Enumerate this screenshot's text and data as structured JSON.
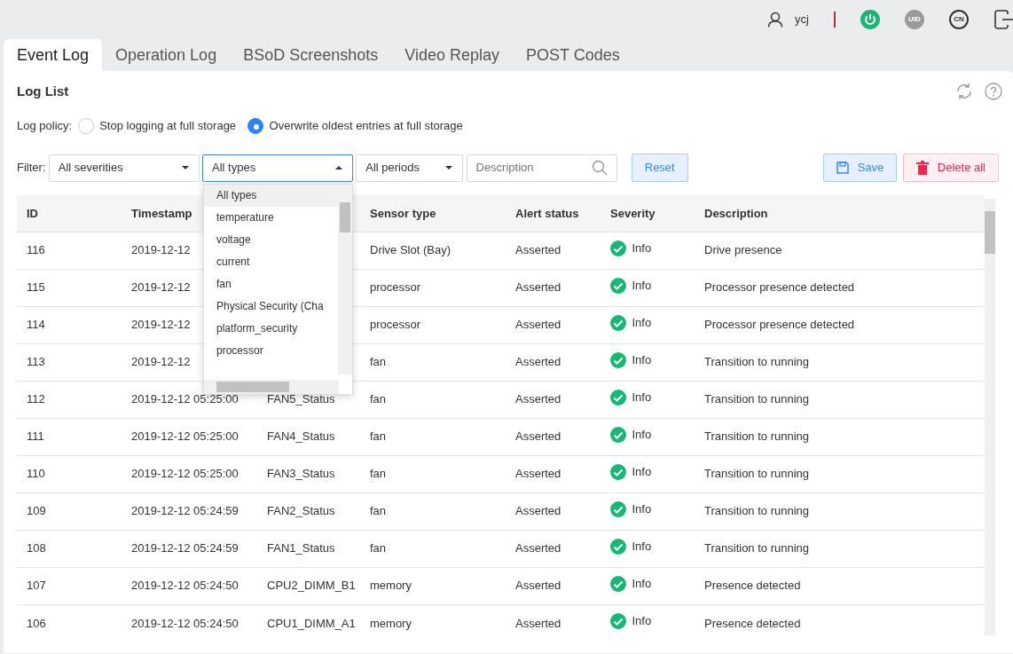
{
  "header": {
    "user": "ycj",
    "cn_label": "CN",
    "uid_label": "UID"
  },
  "tabs": [
    {
      "label": "Event Log",
      "selected": true
    },
    {
      "label": "Operation Log",
      "selected": false
    },
    {
      "label": "BSoD Screenshots",
      "selected": false
    },
    {
      "label": "Video Replay",
      "selected": false
    },
    {
      "label": "POST Codes",
      "selected": false
    }
  ],
  "panel": {
    "title": "Log List"
  },
  "log_policy": {
    "label": "Log policy:",
    "options": [
      {
        "label": "Stop logging at full storage",
        "selected": false
      },
      {
        "label": "Overwrite oldest entries at full storage",
        "selected": true
      }
    ]
  },
  "filter": {
    "label": "Filter:",
    "severity": "All severities",
    "type": "All types",
    "period": "All periods",
    "search_placeholder": "Description",
    "reset": "Reset",
    "save": "Save",
    "delete_all": "Delete all"
  },
  "type_dropdown": {
    "expanded": true,
    "options": [
      {
        "label": "All types",
        "selected": true
      },
      {
        "label": "temperature",
        "selected": false
      },
      {
        "label": "voltage",
        "selected": false
      },
      {
        "label": "current",
        "selected": false
      },
      {
        "label": "fan",
        "selected": false
      },
      {
        "label": "Physical Security (Cha",
        "selected": false
      },
      {
        "label": "platform_security",
        "selected": false
      },
      {
        "label": "processor",
        "selected": false
      }
    ]
  },
  "table": {
    "columns": [
      "ID",
      "Timestamp",
      null,
      "Sensor type",
      "Alert status",
      "Severity",
      "Description"
    ],
    "rows": [
      {
        "id": "116",
        "timestamp": "2019-12-12",
        "sensor_type": "Drive Slot (Bay)",
        "alert": "Asserted",
        "severity": "Info",
        "description": "Drive presence"
      },
      {
        "id": "115",
        "timestamp": "2019-12-12",
        "sensor_type": "processor",
        "alert": "Asserted",
        "severity": "Info",
        "description": "Processor presence detected"
      },
      {
        "id": "114",
        "timestamp": "2019-12-12",
        "sensor_type": "processor",
        "alert": "Asserted",
        "severity": "Info",
        "description": "Processor presence detected"
      },
      {
        "id": "113",
        "timestamp": "2019-12-12",
        "sensor_type": "fan",
        "alert": "Asserted",
        "severity": "Info",
        "description": "Transition to running"
      },
      {
        "id": "112",
        "timestamp": "2019-12-12 05:25:00",
        "sensor": "FAN5_Status",
        "sensor_type": "fan",
        "alert": "Asserted",
        "severity": "Info",
        "description": "Transition to running"
      },
      {
        "id": "111",
        "timestamp": "2019-12-12 05:25:00",
        "sensor": "FAN4_Status",
        "sensor_type": "fan",
        "alert": "Asserted",
        "severity": "Info",
        "description": "Transition to running"
      },
      {
        "id": "110",
        "timestamp": "2019-12-12 05:25:00",
        "sensor": "FAN3_Status",
        "sensor_type": "fan",
        "alert": "Asserted",
        "severity": "Info",
        "description": "Transition to running"
      },
      {
        "id": "109",
        "timestamp": "2019-12-12 05:24:59",
        "sensor": "FAN2_Status",
        "sensor_type": "fan",
        "alert": "Asserted",
        "severity": "Info",
        "description": "Transition to running"
      },
      {
        "id": "108",
        "timestamp": "2019-12-12 05:24:59",
        "sensor": "FAN1_Status",
        "sensor_type": "fan",
        "alert": "Asserted",
        "severity": "Info",
        "description": "Transition to running"
      },
      {
        "id": "107",
        "timestamp": "2019-12-12 05:24:50",
        "sensor": "CPU2_DIMM_B1",
        "sensor_type": "memory",
        "alert": "Asserted",
        "severity": "Info",
        "description": "Presence detected"
      },
      {
        "id": "106",
        "timestamp": "2019-12-12 05:24:50",
        "sensor": "CPU1_DIMM_A1",
        "sensor_type": "memory",
        "alert": "Asserted",
        "severity": "Info",
        "description": "Presence detected"
      }
    ]
  }
}
